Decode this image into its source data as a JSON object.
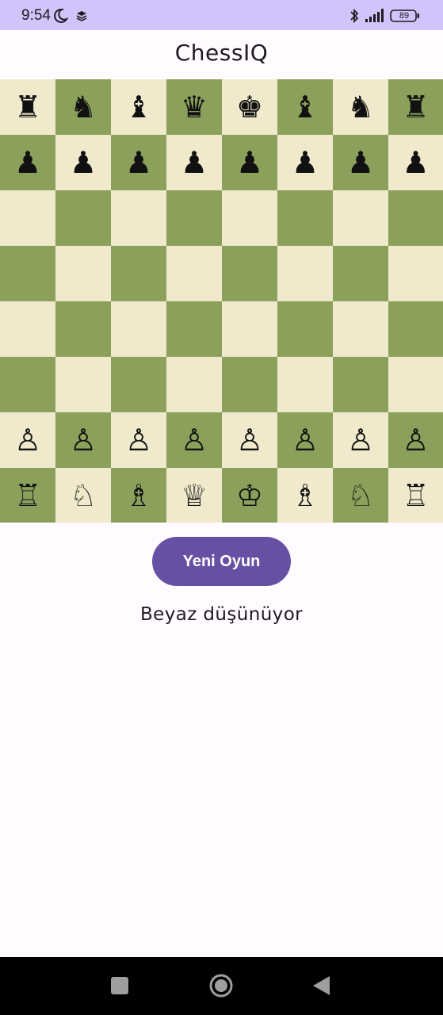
{
  "status_bar": {
    "time": "9:54",
    "battery": "89",
    "background": "#d0c4fb"
  },
  "app": {
    "title": "ChessIQ"
  },
  "board": {
    "light_color": "#f0e9cc",
    "dark_color": "#8ba05a",
    "rows": [
      [
        "♜",
        "♞",
        "♝",
        "♛",
        "♚",
        "♝",
        "♞",
        "♜"
      ],
      [
        "♟",
        "♟",
        "♟",
        "♟",
        "♟",
        "♟",
        "♟",
        "♟"
      ],
      [
        "",
        "",
        "",
        "",
        "",
        "",
        "",
        ""
      ],
      [
        "",
        "",
        "",
        "",
        "",
        "",
        "",
        ""
      ],
      [
        "",
        "",
        "",
        "",
        "",
        "",
        "",
        ""
      ],
      [
        "",
        "",
        "",
        "",
        "",
        "",
        "",
        ""
      ],
      [
        "♙",
        "♙",
        "♙",
        "♙",
        "♙",
        "♙",
        "♙",
        "♙"
      ],
      [
        "♖",
        "♘",
        "♗",
        "♕",
        "♔",
        "♗",
        "♘",
        "♖"
      ]
    ]
  },
  "actions": {
    "new_game_label": "Yeni Oyun",
    "accent": "#6750a4"
  },
  "game_status": "Beyaz düşünüyor",
  "nav": {
    "recents_icon": "recents-square-icon",
    "home_icon": "home-circle-icon",
    "back_icon": "back-triangle-icon"
  }
}
